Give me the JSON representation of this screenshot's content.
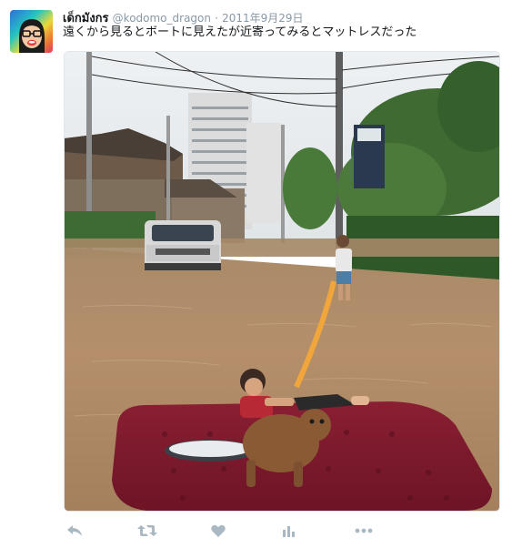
{
  "tweet": {
    "display_name": "เด็กมังกร",
    "handle": "@kodomo_dragon",
    "separator": "·",
    "date": "2011年9月29日",
    "text": "遠くから見るとボートに見えたが近寄ってみるとマットレスだった"
  },
  "actions": {
    "icons": [
      "reply-icon",
      "retweet-icon",
      "like-icon",
      "analytics-icon",
      "more-icon"
    ]
  },
  "colors": {
    "text": "#14171a",
    "secondary": "#8899a6",
    "action_icon": "#aab8c2"
  }
}
